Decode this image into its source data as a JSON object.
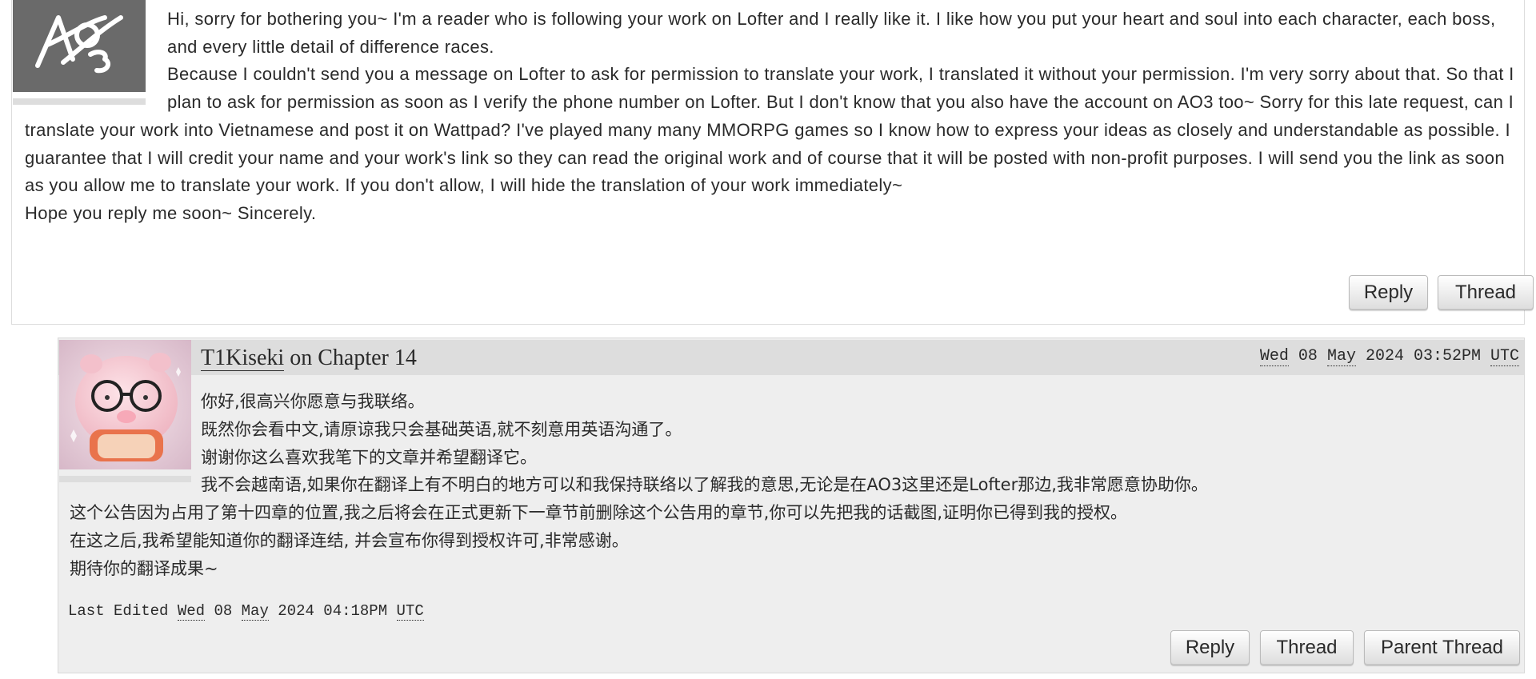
{
  "comment_1": {
    "icon": "ao3-default-user-icon",
    "body_p1": "Hi, sorry for bothering you~ I'm a reader who is following your work on Lofter and I really like it. I like how you put your heart and soul into each character, each boss, and every little detail of difference races.",
    "body_p2": "Because I couldn't send you a message on Lofter to ask for permission to translate your work, I translated it without your permission. I'm very sorry about that. So that I plan to ask for permission as soon as I verify the phone number on Lofter. But I don't know that you also have the account on AO3 too~ Sorry for this late request, can I translate your work into Vietnamese and post it on Wattpad? I've played many many MMORPG games so I know how to express your ideas as closely and understandable as possible. I guarantee that I will credit your name and your work's link so they can read the original work and of course that it will be posted with non-profit purposes. I will send you the link as soon as you allow me to translate your work. If you don't allow, I will hide the translation of your work immediately~",
    "body_p3": "Hope you reply me soon~ Sincerely.",
    "reply_label": "Reply",
    "thread_label": "Thread"
  },
  "comment_2": {
    "author": "T1Kiseki",
    "on_text": " on ",
    "chapter": "Chapter 14",
    "date_weekday": "Wed",
    "date_day": " 08 ",
    "date_month": "May",
    "date_rest": " 2024 03:52PM ",
    "date_tz": "UTC",
    "icon": "pig-with-glasses-avatar",
    "lines": [
      "你好,很高兴你愿意与我联络。",
      "既然你会看中文,请原谅我只会基础英语,就不刻意用英语沟通了。",
      "谢谢你这么喜欢我笔下的文章并希望翻译它。",
      "我不会越南语,如果你在翻译上有不明白的地方可以和我保持联络以了解我的意思,无论是在AO3这里还是Lofter那边,我非常愿意协助你。",
      "这个公告因为占用了第十四章的位置,我之后将会在正式更新下一章节前删除这个公告用的章节,你可以先把我的话截图,证明你已得到我的授权。",
      "在这之后,我希望能知道你的翻译连结, 并会宣布你得到授权许可,非常感谢。",
      "期待你的翻译成果~"
    ],
    "edited_prefix": "Last Edited ",
    "edited_weekday": "Wed",
    "edited_day": " 08 ",
    "edited_month": "May",
    "edited_rest": " 2024 04:18PM ",
    "edited_tz": "UTC",
    "reply_label": "Reply",
    "thread_label": "Thread",
    "parent_thread_label": "Parent Thread"
  }
}
